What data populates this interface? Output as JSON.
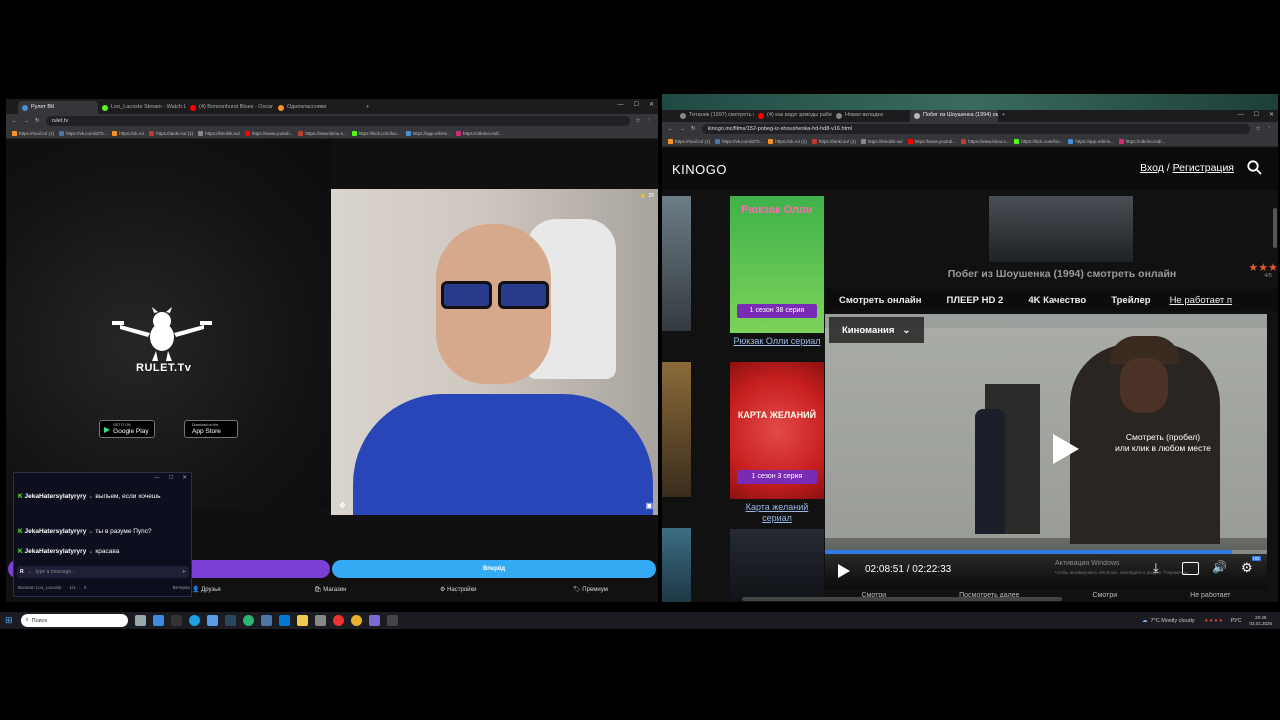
{
  "left_browser": {
    "tabs": [
      {
        "label": "Рулет ВК",
        "color": "#4a90d9",
        "active": true
      },
      {
        "label": "Loo_Lacoste Stream - Watch Li...",
        "color": "#53fc18",
        "active": false
      },
      {
        "label": "(4) Bonsonhurst Blues - Oscar I...",
        "color": "#ff0000",
        "active": false
      },
      {
        "label": "Одноклассники",
        "color": "#f7931e",
        "active": false
      }
    ],
    "url": "rulet.tv",
    "bookmarks": [
      "https://mail.ru/ (1)",
      "https://vk.com/id70...",
      "https://ok.ru/",
      "https://tanki.su/ (1)",
      "https://kinobik.su/",
      "https://www.youtub...",
      "https://www.bimu.s...",
      "https://kick.com/loo...",
      "https://app.rebins...",
      "https://otkrino.md/..."
    ]
  },
  "rulet": {
    "logo_text": "RULET.Tv",
    "google_play": {
      "small": "GET IT ON",
      "big": "Google Play"
    },
    "app_store": {
      "small": "Download on the",
      "big": "App Store"
    },
    "star_count": "25",
    "start_button": "Вперёд",
    "nav": [
      "Друзья",
      "Магазин",
      "Настройки",
      "Премиум"
    ]
  },
  "chat": {
    "messages": [
      {
        "user": "JekaHatersylatyryry",
        "text": "выпьем, если хочешь"
      },
      {
        "user": "JekaHatersylatyryry",
        "text": "ты в разуме Пупс?"
      },
      {
        "user": "JekaHatersylatyryry",
        "text": "красава"
      }
    ],
    "input_placeholder": "type a message...",
    "footer_user": "Bonsam Loo_Lacoste",
    "footer_count": "1/1",
    "footer_viewers": "3",
    "footer_right": "Ветеран"
  },
  "right_browser": {
    "tabs": [
      {
        "label": "Титаник (1997) смотреть онл...",
        "color": "#888",
        "active": false
      },
      {
        "label": "(4) как видя эрмоды рабея так...",
        "color": "#ff0000",
        "active": false
      },
      {
        "label": "Новая вкладка",
        "color": "#888",
        "active": false
      },
      {
        "label": "Побег из Шоушенка (1994) см...",
        "color": "#888",
        "active": true
      }
    ],
    "url": "kinogo.inc/films/152-pobeg-iz-shoushenka-hd-hd8-v16.html",
    "bookmarks": [
      "https://mail.ru/ (1)",
      "https://vk.com/id70...",
      "https://ok.ru/ (1)",
      "https://tanki.su/ (1)",
      "https://kinobik.su/",
      "https://www.youtub...",
      "https://www.bimu.s...",
      "https://kick.com/loo...",
      "https://app.rebins...",
      "https://otkrino.md/..."
    ]
  },
  "kinogo": {
    "logo": "KINOGO",
    "login": "Вход",
    "separator": "/",
    "register": "Регистрация",
    "page_title": "Побег из Шоушенка (1994) смотреть онлайн",
    "rating": "4/5",
    "tabs": [
      "Смотреть онлайн",
      "ПЛЕЕР HD 2",
      "4K Качество",
      "Трейлер",
      "Не работает п"
    ],
    "player_source": "Киномания",
    "play_hint_line1": "Смотреть (пробел)",
    "play_hint_line2": "или клик в любом месте",
    "time": "02:08:51 / 02:22:33",
    "hd_badge": "HD",
    "progress": 0.92,
    "watermark_line1": "Активация Windows",
    "watermark_line2": "Чтобы активировать Windows, перейдите в раздел \"Параметры\".",
    "bottom_links": [
      "Смотри",
      "Посмотреть далее",
      "Смотри",
      "Не работает"
    ],
    "cards": [
      {
        "title_art": "Рюкзак Олли",
        "badge": "1 сезон 38 серия",
        "caption": "Рюкзак Олли сериал"
      },
      {
        "title_art": "КАРТА ЖЕЛАНИЙ",
        "badge": "1 сезон 3 серия",
        "caption": "Карта желаний сериал"
      },
      {
        "title_art": "",
        "badge": "",
        "caption": ""
      }
    ]
  },
  "taskbar": {
    "search": "Поиск",
    "weather": "7°C Mostly cloudy",
    "lang": "РУС",
    "time": "20:45",
    "date": "03.01.2026"
  }
}
